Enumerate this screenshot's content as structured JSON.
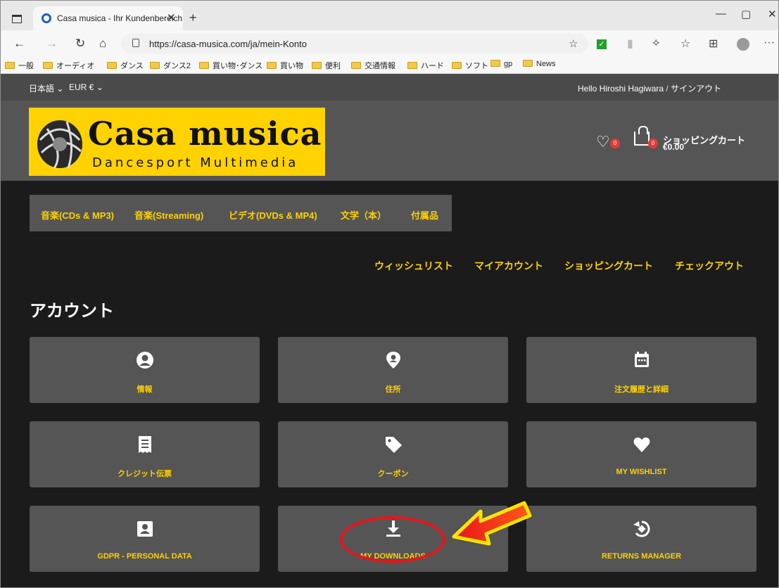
{
  "browser": {
    "tab_title": "Casa musica - Ihr Kundenbereich",
    "url": "https://casa-musica.com/ja/mein-Konto",
    "bookmarks": [
      "一般",
      "オーディオ",
      "ダンス",
      "ダンス2",
      "買い物･ダンス",
      "買い物",
      "便利",
      "交通情報",
      "ハード",
      "ソフト",
      "gp",
      "News"
    ]
  },
  "topbar": {
    "language": "日本語",
    "currency": "EUR €",
    "hello": "Hello Hiroshi Hagiwara",
    "signout": "サインアウト"
  },
  "header": {
    "logo_main": "Casa musica",
    "logo_sub": "Dancesport Multimedia",
    "wishlist_count": "0",
    "cart_count": "0",
    "cart_label": "ショッピングカート",
    "cart_amount": "€0.00"
  },
  "menu": [
    "音楽(CDs & MP3)",
    "音楽(Streaming)",
    "ビデオ(DVDs & MP4)",
    "文学（本）",
    "付属品"
  ],
  "links": [
    "ウィッシュリスト",
    "マイアカウント",
    "ショッピングカート",
    "チェックアウト"
  ],
  "page_title": "アカウント",
  "cards": [
    {
      "label": "情報",
      "icon": "user-circle-icon"
    },
    {
      "label": "住所",
      "icon": "map-pin-icon"
    },
    {
      "label": "注文履歴と詳細",
      "icon": "calendar-icon"
    },
    {
      "label": "クレジット伝票",
      "icon": "receipt-icon"
    },
    {
      "label": "クーポン",
      "icon": "tag-icon"
    },
    {
      "label": "MY WISHLIST",
      "icon": "heart-icon"
    },
    {
      "label": "GDPR - PERSONAL DATA",
      "icon": "id-card-icon"
    },
    {
      "label": "MY DOWNLOADS",
      "icon": "download-icon"
    },
    {
      "label": "RETURNS MANAGER",
      "icon": "returns-icon"
    }
  ],
  "colors": {
    "accent": "#ffd200",
    "card_bg": "#555555",
    "page_bg": "#1b1b1b",
    "annotation": "#e8141c"
  }
}
